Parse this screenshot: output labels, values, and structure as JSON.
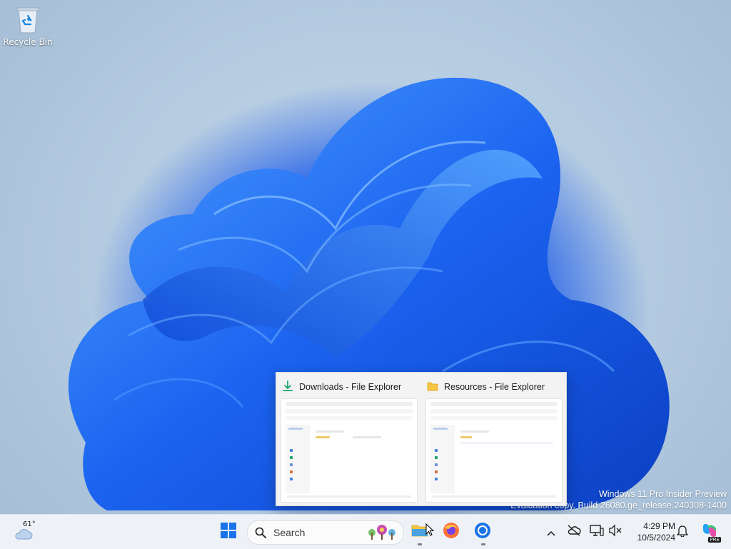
{
  "desktop": {
    "icons": [
      {
        "label": "Recycle Bin",
        "icon": "recycle-bin-icon"
      }
    ],
    "watermark": {
      "line1": "Windows 11 Pro Insider Preview",
      "line2": "Evaluation copy. Build 26080.ge_release.240308-1400"
    }
  },
  "taskbar_preview": {
    "windows": [
      {
        "title": "Downloads - File Explorer",
        "icon": "download-arrow-icon"
      },
      {
        "title": "Resources - File Explorer",
        "icon": "folder-icon"
      }
    ]
  },
  "taskbar": {
    "weather": {
      "temp": "61°",
      "icon": "cloud-icon"
    },
    "start": {
      "icon": "windows-start-icon"
    },
    "search": {
      "label": "Search"
    },
    "apps": [
      {
        "name": "File Explorer",
        "icon": "file-explorer-icon",
        "running": true
      },
      {
        "name": "Firefox",
        "icon": "firefox-icon",
        "running": false
      },
      {
        "name": "Chrome",
        "icon": "chrome-icon",
        "running": true
      }
    ],
    "tray": {
      "icons": [
        "chevron-up-icon",
        "cloud-offline-icon",
        "display-icon",
        "settings-sync-icon"
      ],
      "time": "4:29 PM",
      "date": "10/5/2024",
      "notification_icon": "bell-icon",
      "copilot_badge": "PRE"
    }
  }
}
